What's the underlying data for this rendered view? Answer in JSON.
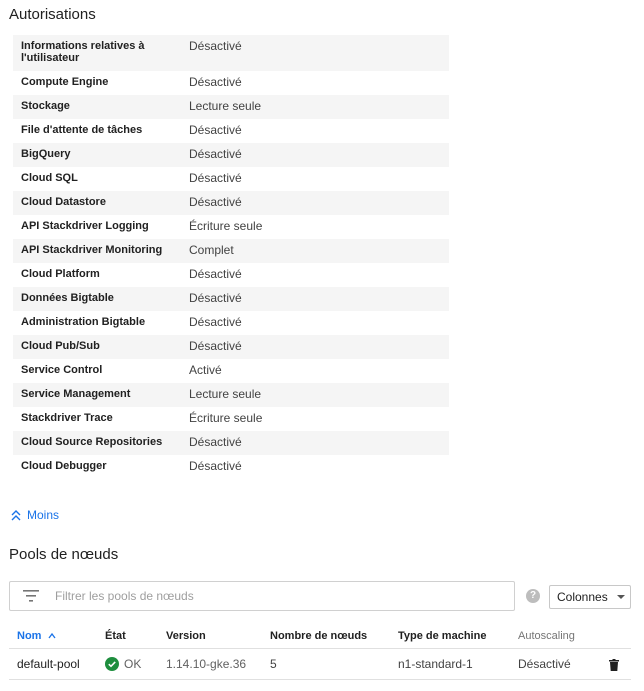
{
  "permissions": {
    "title": "Autorisations",
    "rows": [
      {
        "label": "Informations relatives à l'utilisateur",
        "value": "Désactivé"
      },
      {
        "label": "Compute Engine",
        "value": "Désactivé"
      },
      {
        "label": "Stockage",
        "value": "Lecture seule"
      },
      {
        "label": "File d'attente de tâches",
        "value": "Désactivé"
      },
      {
        "label": "BigQuery",
        "value": "Désactivé"
      },
      {
        "label": "Cloud SQL",
        "value": "Désactivé"
      },
      {
        "label": "Cloud Datastore",
        "value": "Désactivé"
      },
      {
        "label": "API Stackdriver Logging",
        "value": "Écriture seule"
      },
      {
        "label": "API Stackdriver Monitoring",
        "value": "Complet"
      },
      {
        "label": "Cloud Platform",
        "value": "Désactivé"
      },
      {
        "label": "Données Bigtable",
        "value": "Désactivé"
      },
      {
        "label": "Administration Bigtable",
        "value": "Désactivé"
      },
      {
        "label": "Cloud Pub/Sub",
        "value": "Désactivé"
      },
      {
        "label": "Service Control",
        "value": "Activé"
      },
      {
        "label": "Service Management",
        "value": "Lecture seule"
      },
      {
        "label": "Stackdriver Trace",
        "value": "Écriture seule"
      },
      {
        "label": "Cloud Source Repositories",
        "value": "Désactivé"
      },
      {
        "label": "Cloud Debugger",
        "value": "Désactivé"
      }
    ],
    "less_label": "Moins"
  },
  "node_pools": {
    "title": "Pools de nœuds",
    "filter_placeholder": "Filtrer les pools de nœuds",
    "columns_button": "Colonnes",
    "headers": {
      "name": "Nom",
      "status": "État",
      "version": "Version",
      "node_count": "Nombre de nœuds",
      "machine_type": "Type de machine",
      "autoscaling": "Autoscaling"
    },
    "rows": [
      {
        "name": "default-pool",
        "status": "OK",
        "version": "1.14.10-gke.36",
        "node_count": "5",
        "machine_type": "n1-standard-1",
        "autoscaling": "Désactivé"
      }
    ]
  },
  "colors": {
    "accent": "#1a73e8",
    "status_ok": "#1e8e3e",
    "zebra": "#f5f5f5"
  },
  "icons": {
    "less": "chevron-up-double-icon",
    "filter": "filter-icon",
    "help": "help-icon",
    "dropdown": "caret-down-icon",
    "sort": "sort-arrow-up-icon",
    "status_ok": "check-circle-icon",
    "delete": "trash-icon"
  }
}
